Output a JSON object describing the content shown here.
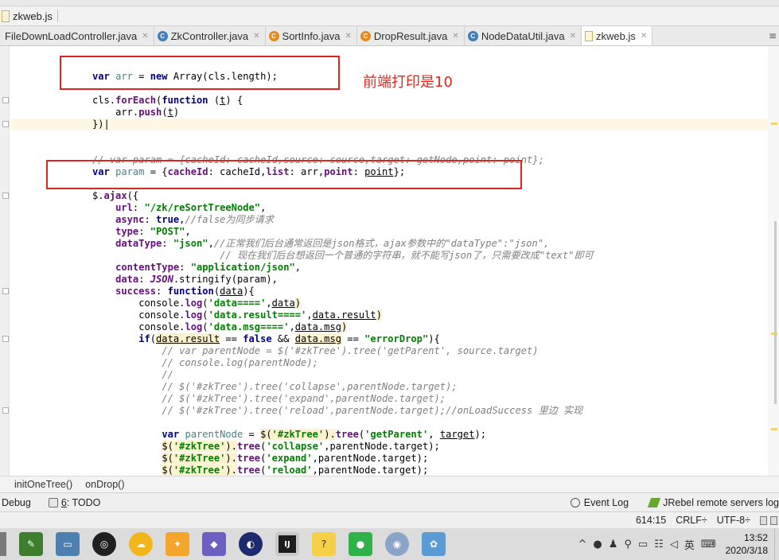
{
  "window": {
    "breadcrumb_file": "zkweb.js"
  },
  "tabs": [
    {
      "label": "FileDownLoadController.java",
      "icon": "java-class-icon"
    },
    {
      "label": "ZkController.java",
      "icon": "java-class-icon"
    },
    {
      "label": "SortInfo.java",
      "icon": "java-class-icon"
    },
    {
      "label": "DropResult.java",
      "icon": "java-class-icon"
    },
    {
      "label": "NodeDataUtil.java",
      "icon": "java-class-icon"
    },
    {
      "label": "zkweb.js",
      "icon": "js-file-icon",
      "active": true
    }
  ],
  "annotation": "前端打印是10",
  "code": {
    "l1": {
      "kw1": "var",
      "id1": "arr",
      "eq": " = ",
      "kw2": "new",
      "rest": " Array(cls.length);"
    },
    "l3": {
      "a": "cls.",
      "b": "forEach",
      "c": "(",
      "kw": "function",
      "d": " (",
      "t": "t",
      "e": ") {"
    },
    "l4": {
      "a": "arr.",
      "b": "push",
      "c": "(",
      "t": "t",
      "d": ")"
    },
    "l5": {
      "a": "})"
    },
    "l7": {
      "cmt": "// var param = {cacheId: cacheId,source: source,target: getNode,point: point};"
    },
    "l8": {
      "kw": "var",
      "id": "param",
      "a": " = {",
      "k1": "cacheId",
      "b": ": cacheId,",
      "k2": "list",
      "c": ": arr,",
      "k3": "point",
      "d": ": ",
      "p": "point",
      "e": "};"
    },
    "l10": {
      "a": "$.",
      "b": "ajax",
      "c": "({"
    },
    "l11": {
      "k": "url",
      "a": ": ",
      "s": "\"/zk/reSortTreeNode\"",
      "b": ","
    },
    "l12": {
      "k": "async",
      "a": ": ",
      "kw": "true",
      "b": ",",
      "cmt": "//false为同步请求"
    },
    "l13": {
      "k": "type",
      "a": ": ",
      "s": "\"POST\"",
      "b": ","
    },
    "l14": {
      "k": "dataType",
      "a": ": ",
      "s": "\"json\"",
      "b": ",",
      "cmt": "//正常我们后台通常返回是json格式，ajax参数中的\"dataType\":\"json\","
    },
    "l15": {
      "cmt": "// 现在我们后台想返回一个普通的字符串，就不能写json了，只需要改成\"text\"即可"
    },
    "l16": {
      "k": "contentType",
      "a": ": ",
      "s": "\"application/json\"",
      "b": ","
    },
    "l17": {
      "k": "data",
      "a": ": ",
      "g": "JSON",
      "b": ".",
      "c": "stringify",
      "d": "(param),"
    },
    "l18": {
      "k": "success",
      "a": ": ",
      "kw": "function",
      "b": "(",
      "p": "data",
      "c": "){"
    },
    "l19": {
      "a": "console.",
      "b": "log",
      "c": "(",
      "s": "'data===='",
      "d": ",",
      "p": "data",
      "e": ")"
    },
    "l20": {
      "a": "console.",
      "b": "log",
      "c": "(",
      "s": "'data.result===='",
      "d": ",",
      "p": "data.result",
      "e": ")"
    },
    "l21": {
      "a": "console.",
      "b": "log",
      "c": "(",
      "s": "'data.msg===='",
      "d": ",",
      "p": "data.msg",
      "e": ")"
    },
    "l22": {
      "kw": "if",
      "a": "(",
      "p1": "data.result",
      "b": " == ",
      "kw2": "false",
      "c": " && ",
      "p2": "data.msg",
      "d": " == ",
      "s": "\"errorDrop\"",
      "e": "){"
    },
    "l23": {
      "cmt": "// var parentNode = $('#zkTree').tree('getParent', source.target)"
    },
    "l24": {
      "cmt": "// console.log(parentNode);"
    },
    "l25": {
      "cmt": "//"
    },
    "l26": {
      "cmt": "// $('#zkTree').tree('collapse',parentNode.target);"
    },
    "l27": {
      "cmt": "// $('#zkTree').tree('expand',parentNode.target);"
    },
    "l28": {
      "cmt": "// $('#zkTree').tree('reload',parentNode.target);//onLoadSuccess 里边 实现"
    },
    "l30": {
      "kw": "var",
      "id": "parentNode",
      "a": " = ",
      "b": "$(",
      "s1": "'#zkTree'",
      "c": ").",
      "d": "tree",
      "e": "(",
      "s2": "'getParent'",
      "f": ", ",
      "t": "target",
      "g": ");"
    },
    "l31": {
      "b": "$(",
      "s1": "'#zkTree'",
      "c": ").",
      "d": "tree",
      "e": "(",
      "s2": "'collapse'",
      "f": ",",
      "g": "parentNode.target);"
    },
    "l32": {
      "b": "$(",
      "s1": "'#zkTree'",
      "c": ").",
      "d": "tree",
      "e": "(",
      "s2": "'expand'",
      "f": ",",
      "g": "parentNode.target);"
    },
    "l33": {
      "b": "$(",
      "s1": "'#zkTree'",
      "c": ").",
      "d": "tree",
      "e": "(",
      "s2": "'reload'",
      "f": ",",
      "g": "parentNode.target);"
    }
  },
  "editor_breadcrumb": [
    "initOneTree()",
    "onDrop()"
  ],
  "toolwindows": {
    "debug": "Debug",
    "todo_num": "6",
    "todo_rest": ": TODO",
    "event_log": "Event Log",
    "jrebel": "JRebel remote servers log"
  },
  "status": {
    "position": "614:15",
    "line_sep": "CRLF÷",
    "encoding": "UTF-8÷"
  },
  "taskbar": {
    "time": "13:52",
    "date": "2020/3/18",
    "ime": "英",
    "tray_chevron": "^"
  }
}
